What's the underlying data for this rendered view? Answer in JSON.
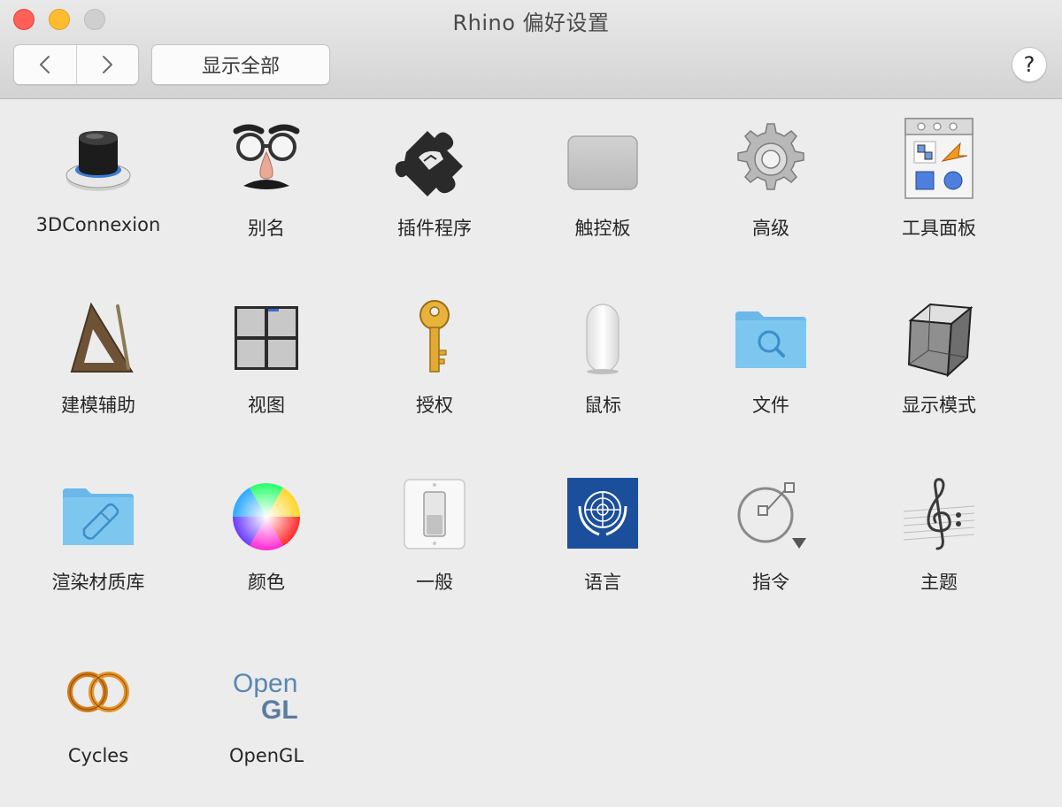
{
  "window": {
    "title": "Rhino 偏好设置"
  },
  "toolbar": {
    "back_icon": "chevron-left-icon",
    "forward_icon": "chevron-right-icon",
    "show_all_label": "显示全部",
    "help_label": "?"
  },
  "panes": [
    {
      "label": "3DConnexion",
      "icon": "3d-mouse-icon"
    },
    {
      "label": "别名",
      "icon": "glasses-nose-icon"
    },
    {
      "label": "插件程序",
      "icon": "puzzle-rhino-icon"
    },
    {
      "label": "触控板",
      "icon": "trackpad-icon"
    },
    {
      "label": "高级",
      "icon": "gear-icon"
    },
    {
      "label": "工具面板",
      "icon": "tool-palette-icon"
    },
    {
      "label": "建模辅助",
      "icon": "triangle-ruler-icon"
    },
    {
      "label": "视图",
      "icon": "four-viewports-icon"
    },
    {
      "label": "授权",
      "icon": "key-icon"
    },
    {
      "label": "鼠标",
      "icon": "mouse-icon"
    },
    {
      "label": "文件",
      "icon": "folder-search-icon"
    },
    {
      "label": "显示模式",
      "icon": "wireframe-cube-icon"
    },
    {
      "label": "渲染材质库",
      "icon": "material-folder-icon"
    },
    {
      "label": "颜色",
      "icon": "color-wheel-icon"
    },
    {
      "label": "一般",
      "icon": "light-switch-icon"
    },
    {
      "label": "语言",
      "icon": "un-flag-icon"
    },
    {
      "label": "指令",
      "icon": "command-circle-icon"
    },
    {
      "label": "主题",
      "icon": "music-clef-icon"
    },
    {
      "label": "Cycles",
      "icon": "linked-rings-icon"
    },
    {
      "label": "OpenGL",
      "icon": "opengl-logo-icon"
    }
  ],
  "opengl_logo": {
    "line1": "Open",
    "line2": "GL"
  },
  "colors": {
    "close": "#fe5f57",
    "minimize": "#febc2e",
    "zoom_disabled": "#cfcfcf",
    "folder_blue": "#7cc6f0",
    "un_blue": "#1b4f9c"
  }
}
